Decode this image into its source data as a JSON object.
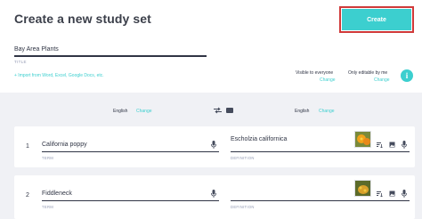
{
  "header": {
    "title": "Create a new study set",
    "create_label": "Create"
  },
  "set": {
    "title_value": "Bay Area Plants",
    "title_caption": "TITLE",
    "import_link": "+ Import from Word, Excel, Google Docs, etc."
  },
  "settings": {
    "visible_label": "Visible to everyone",
    "visible_change": "Change",
    "editable_label": "Only editable by me",
    "editable_change": "Change",
    "info_symbol": "i"
  },
  "languages": {
    "term_language": "English",
    "term_change": "Change",
    "definition_language": "English",
    "definition_change": "Change"
  },
  "cards": [
    {
      "number": "1",
      "term": "California poppy",
      "definition": "Escholzia californica",
      "term_caption": "TERM",
      "definition_caption": "DEFINITION",
      "image": "poppy-thumbnail"
    },
    {
      "number": "2",
      "term": "Fiddleneck",
      "definition": "",
      "term_caption": "TERM",
      "definition_caption": "DEFINITION",
      "image": "fiddleneck-thumbnail"
    }
  ],
  "icons": {
    "mic": "microphone-icon",
    "sort": "sort-icon",
    "image": "image-icon",
    "swap": "swap-arrows-icon",
    "keyboard": "keyboard-icon"
  },
  "colors": {
    "accent": "#3ccfcf",
    "highlight_border": "#d03a3a",
    "text": "#303545",
    "muted": "#939bb4",
    "body_bg": "#f0f1f5"
  }
}
